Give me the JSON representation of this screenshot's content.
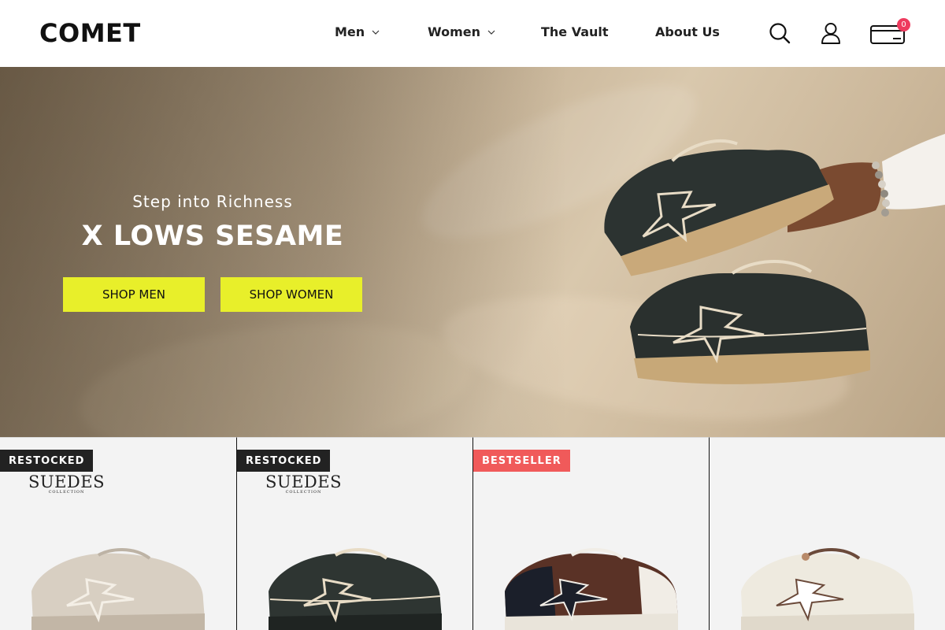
{
  "brand": {
    "logo_text": "COMET"
  },
  "nav": {
    "items": [
      {
        "label": "Men",
        "has_dropdown": true
      },
      {
        "label": "Women",
        "has_dropdown": true
      },
      {
        "label": "The Vault",
        "has_dropdown": false
      },
      {
        "label": "About Us",
        "has_dropdown": false
      }
    ],
    "icons": {
      "search": "search-icon",
      "account": "user-icon",
      "cart": "cart-icon"
    },
    "cart_count": "0"
  },
  "hero": {
    "subtitle": "Step into Richness",
    "title": "X LOWS SESAME",
    "buttons": [
      {
        "label": "SHOP MEN"
      },
      {
        "label": "SHOP WOMEN"
      }
    ]
  },
  "products": [
    {
      "badge": "RESTOCKED",
      "collection": "SUEDES",
      "collection_sub": "COLLECTION",
      "shoe_color": "#d8cfc2"
    },
    {
      "badge": "RESTOCKED",
      "collection": "SUEDES",
      "collection_sub": "COLLECTION",
      "shoe_color": "#2e3532"
    },
    {
      "badge": "BESTSELLER",
      "collection": "",
      "collection_sub": "",
      "shoe_color": "#5a3226"
    },
    {
      "badge": "",
      "collection": "",
      "collection_sub": "",
      "shoe_color": "#eeeadf"
    }
  ],
  "colors": {
    "accent": "#e8ef2a",
    "badge_dark": "#222222",
    "badge_red": "#f05a5a",
    "cart_badge": "#ee3b5e"
  }
}
